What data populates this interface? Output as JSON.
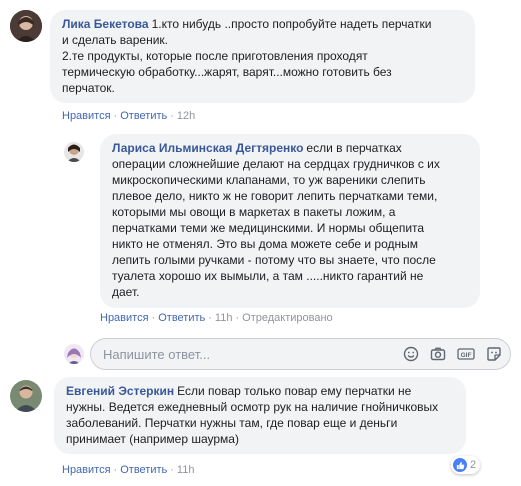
{
  "comments": [
    {
      "author": "Лика Бекетова",
      "text": "1.кто нибудь ..просто попробуйте надеть перчатки\nи сделать вареник.\n2.те продукты, которые после приготовления проходят\nтермическую обработку...жарят, варят...можно готовить без\nперчаток.",
      "like": "Нравится",
      "reply": "Ответить",
      "time": "12h"
    },
    {
      "author": "Лариса Ильминская Дегтяренко",
      "text": "если в перчатках\nоперации сложнейшие делают на сердцах грудничков с их\nмикроскопическими клапанами, то уж вареники слепить\nплевое дело, никто ж не говорит лепить перчатками теми,\nкоторыми мы овощи в маркетах в пакеты ложим, а\nперчатками теми же медицинскими. И нормы общепита\nникто не отменял. Это вы дома можете себе и родным\nлепить голыми ручками - потому что вы знаете, что после\nтуалета хорошо их вымыли, а там .....никто гарантий не\nдает.",
      "like": "Нравится",
      "reply": "Ответить",
      "time": "11h",
      "edited": "Отредактировано"
    },
    {
      "author": "Евгений Эстеркин",
      "text": "Если повар только повар ему перчатки не\nнужны. Ведется ежедневный осмотр рук на наличие гнойничковых\nзаболеваний. Перчатки нужны там, где повар еще и деньги\nпринимает (например шаурма)",
      "like": "Нравится",
      "reply": "Ответить",
      "time": "11h",
      "reaction_count": "2"
    }
  ],
  "reply_box": {
    "placeholder": "Напишите ответ..."
  },
  "icons": [
    "emoji-icon",
    "camera-icon",
    "gif-icon",
    "sticker-icon",
    "like-reaction-icon"
  ],
  "colors": {
    "author": "#385898",
    "link": "#4267b2",
    "bubble": "#f2f3f5",
    "meta": "#90949c",
    "like": "#4a80f5"
  }
}
